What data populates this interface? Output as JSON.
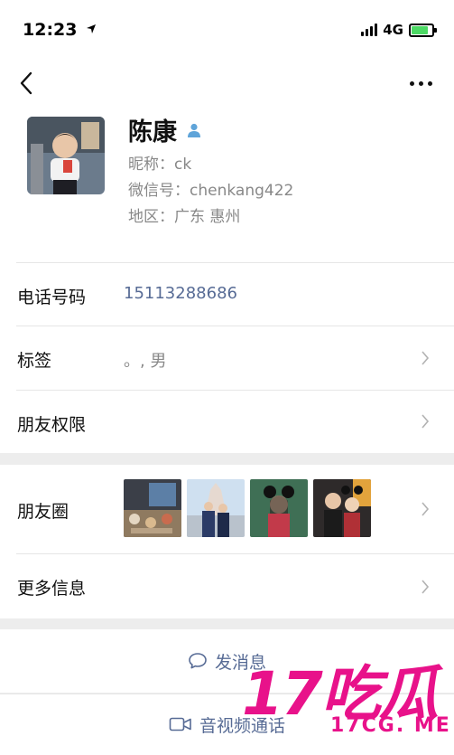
{
  "status_bar": {
    "time": "12:23",
    "network": "4G",
    "battery_level": 0.8
  },
  "nav": {
    "back_icon": "chevron-left-icon",
    "more_icon": "more-dots-icon"
  },
  "profile": {
    "name": "陈康",
    "gender_icon": "person-male-icon",
    "nickname": "昵称：ck",
    "wechat_id": "微信号：chenkang422",
    "region": "地区：广东 惠州"
  },
  "rows": {
    "phone": {
      "label": "电话号码",
      "value": "15113288686"
    },
    "tags": {
      "label": "标签",
      "value": "。, 男"
    },
    "permissions": {
      "label": "朋友权限"
    },
    "moments": {
      "label": "朋友圈"
    },
    "more_info": {
      "label": "更多信息"
    }
  },
  "actions": {
    "message": "发消息",
    "video_call": "音视频通话"
  },
  "watermark": {
    "text_large": "17吃瓜",
    "text_small": "17CG. ME"
  },
  "colors": {
    "link": "#576b95",
    "watermark": "#e8128a",
    "background": "#ededed"
  }
}
